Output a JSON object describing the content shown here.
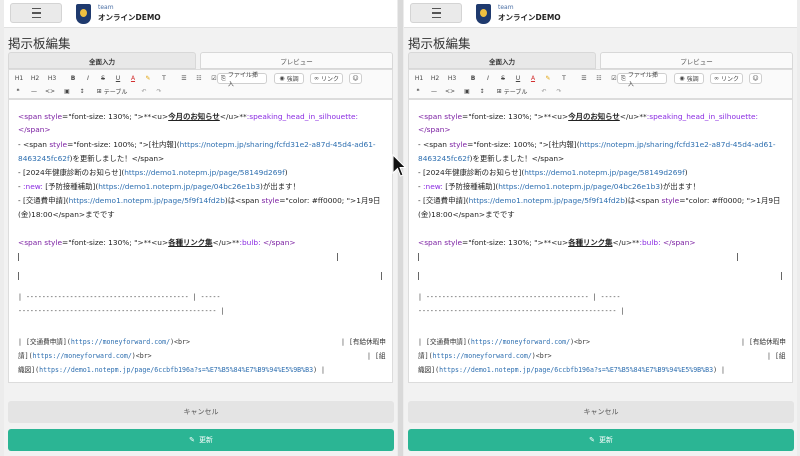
{
  "header": {
    "team_label": "team",
    "team_name": "オンラインDEMO"
  },
  "page_title": "掲示板編集",
  "tabs": [
    {
      "label": "全面入力"
    },
    {
      "label": "プレビュー"
    }
  ],
  "toolbar": {
    "h1": "H1",
    "h2": "H2",
    "h3": "H3",
    "bold": "B",
    "italic": "I",
    "strike": "S",
    "underline": "U",
    "color": "A",
    "marker": "✎",
    "font": "T",
    "ul": "☰",
    "ol": "☷",
    "check": "☑",
    "file_insert": "ファイル挿入",
    "emphasis": "強調",
    "link": "リンク",
    "emoji": "☺",
    "quote": "❝",
    "hr": "—",
    "code": "<>",
    "image": "▣",
    "height": "↕",
    "table": "テーブル",
    "undo": "↶",
    "redo": "↷"
  },
  "editor": {
    "l1_a": "<span ",
    "l1_b": "style",
    "l1_c": "=\"font-size: 130%; \">**<u>",
    "l1_d": "今月のお知らせ",
    "l1_e": "</u>**",
    "l1_f": ":speaking_head_in_silhouette:",
    "l2": "</span>",
    "l3_a": "- <span ",
    "l3_b": "style",
    "l3_c": "=\"font-size: 100%; \">[社内報](",
    "l3_d": "https://notepm.jp/sharing/fcfd31e2-a87d-45d4-ad61-",
    "l4_a": "8463245fc62f",
    "l4_b": ")を更新しました！</span>",
    "l5_a": "- [2024年健康診断のお知らせ](",
    "l5_b": "https://demo1.notepm.jp/page/58149d269f",
    "l5_c": ")",
    "l6_a": "- ",
    "l6_b": ":new:",
    "l6_c": " [予防接種補助](",
    "l6_d": "https://demo1.notepm.jp/page/04bc26e1b3",
    "l6_e": ")が出ます！",
    "l7_a": "- [交通費申請](",
    "l7_b": "https://demo1.notepm.jp/page/5f9f14fd2b",
    "l7_c": ")は<span ",
    "l7_d": "style",
    "l7_e": "=\"color: #ff0000; \">1月9日",
    "l8": "(金)18:00</span>までです",
    "l9_a": "<span ",
    "l9_b": "style",
    "l9_c": "=\"font-size: 130%; \">**<u>",
    "l9_d": "各種リンク集",
    "l9_e": "</u>**",
    "l9_f": ":bulb:",
    "l9_g": " </span>",
    "dash1": "| ----------------------------------------- | -----",
    "dash2": "-------------------------------------------------- |",
    "m1_a": "| [交通費申請](",
    "m1_b": "https://moneyforward.com/",
    "m1_c": ")<br>",
    "m1_d": "| [有給休暇申",
    "m2_a": "請](",
    "m2_b": "https://moneyforward.com/",
    "m2_c": ")<br>",
    "m2_d": "| [組",
    "m3_a": "織図](",
    "m3_b": "https://demo1.notepm.jp/page/6ccbfb196a?s=%E7%B5%84%E7%B9%94%E5%9B%B3",
    "m3_c": ") |"
  },
  "buttons": {
    "cancel": "キャンセル",
    "update": "更新"
  }
}
